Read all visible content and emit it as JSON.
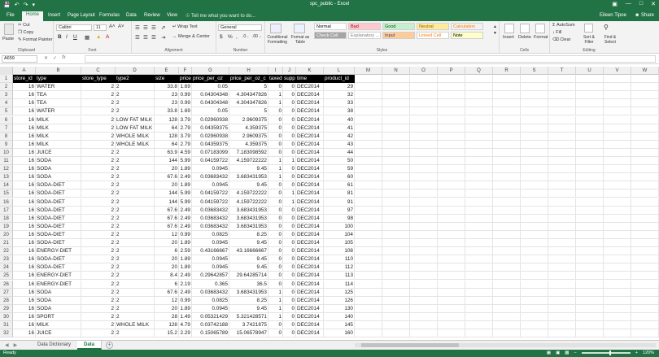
{
  "window": {
    "title": "spc_public - Excel",
    "user": "Eileen Tipoe",
    "share": "Share"
  },
  "tabs": [
    "File",
    "Home",
    "Insert",
    "Page Layout",
    "Formulas",
    "Data",
    "Review",
    "View"
  ],
  "tell_me": "Tell me what you want to do...",
  "ribbon": {
    "clipboard": {
      "paste": "Paste",
      "cut": "Cut",
      "copy": "Copy",
      "format_painter": "Format Painter",
      "label": "Clipboard"
    },
    "font": {
      "name": "Calibri",
      "size": "11",
      "label": "Font"
    },
    "alignment": {
      "wrap": "Wrap Text",
      "merge": "Merge & Center",
      "label": "Alignment"
    },
    "number": {
      "format": "General",
      "label": "Number"
    },
    "styles": {
      "conditional": "Conditional Formatting",
      "format_table": "Format as Table",
      "cells": [
        {
          "name": "Normal",
          "bg": "#ffffff",
          "fg": "#000000"
        },
        {
          "name": "Bad",
          "bg": "#ffc7ce",
          "fg": "#9c0006"
        },
        {
          "name": "Good",
          "bg": "#c6efce",
          "fg": "#006100"
        },
        {
          "name": "Neutral",
          "bg": "#ffeb9c",
          "fg": "#9c5700"
        },
        {
          "name": "Calculation",
          "bg": "#f2f2f2",
          "fg": "#fa7d00"
        },
        {
          "name": "Check Cell",
          "bg": "#a5a5a5",
          "fg": "#ffffff"
        },
        {
          "name": "Explanatory ...",
          "bg": "#ffffff",
          "fg": "#7f7f7f"
        },
        {
          "name": "Input",
          "bg": "#ffcc99",
          "fg": "#3f3f76"
        },
        {
          "name": "Linked Cell",
          "bg": "#ffffff",
          "fg": "#fa7d00"
        },
        {
          "name": "Note",
          "bg": "#ffffcc",
          "fg": "#000000"
        }
      ],
      "label": "Styles"
    },
    "cells": {
      "insert": "Insert",
      "delete": "Delete",
      "format": "Format",
      "label": "Cells"
    },
    "editing": {
      "autosum": "AutoSum",
      "fill": "Fill",
      "clear": "Clear",
      "sort": "Sort & Filter",
      "find": "Find & Select",
      "label": "Editing"
    }
  },
  "formula_bar": {
    "name_box": "A659",
    "fx": "fx"
  },
  "columns": [
    "A",
    "B",
    "C",
    "D",
    "E",
    "F",
    "G",
    "H",
    "I",
    "J",
    "K",
    "L",
    "M",
    "N",
    "O",
    "P",
    "Q",
    "R",
    "S",
    "T",
    "U",
    "V",
    "W"
  ],
  "row_numbers": [
    "1",
    "2",
    "3",
    "4",
    "5",
    "6",
    "7",
    "8",
    "9",
    "10",
    "11",
    "12",
    "13",
    "14",
    "15",
    "16",
    "17",
    "18",
    "19",
    "20",
    "21",
    "22",
    "23",
    "24",
    "25",
    "26",
    "27",
    "28",
    "29",
    "30",
    "31",
    "32"
  ],
  "header_row": [
    "store_id",
    "type",
    "store_type",
    "type2",
    "size",
    "price",
    "price_per_oz",
    "price_per_oz_c",
    "taxed",
    "supp",
    "time",
    "product_id"
  ],
  "rows": [
    [
      "16",
      "WATER",
      "2",
      "2",
      "33.8",
      "1.69",
      "0.05",
      "5",
      "0",
      "0",
      "DEC2014",
      "29"
    ],
    [
      "16",
      "TEA",
      "2",
      "2",
      "23",
      "0.99",
      "0.04304348",
      "4.304347826",
      "1",
      "0",
      "DEC2014",
      "32"
    ],
    [
      "16",
      "TEA",
      "2",
      "2",
      "23",
      "0.99",
      "0.04304348",
      "4.304347826",
      "1",
      "0",
      "DEC2014",
      "33"
    ],
    [
      "16",
      "WATER",
      "2",
      "2",
      "33.8",
      "1.69",
      "0.05",
      "5",
      "0",
      "0",
      "DEC2014",
      "38"
    ],
    [
      "16",
      "MILK",
      "2",
      "LOW FAT MILK",
      "128",
      "3.79",
      "0.02960938",
      "2.9609375",
      "0",
      "0",
      "DEC2014",
      "40"
    ],
    [
      "16",
      "MILK",
      "2",
      "LOW FAT MILK",
      "64",
      "2.79",
      "0.04359375",
      "4.359375",
      "0",
      "0",
      "DEC2014",
      "41"
    ],
    [
      "16",
      "MILK",
      "2",
      "WHOLE MILK",
      "128",
      "3.79",
      "0.02960938",
      "2.9609375",
      "0",
      "0",
      "DEC2014",
      "42"
    ],
    [
      "16",
      "MILK",
      "2",
      "WHOLE MILK",
      "64",
      "2.79",
      "0.04359375",
      "4.359375",
      "0",
      "0",
      "DEC2014",
      "43"
    ],
    [
      "16",
      "JUICE",
      "2",
      "2",
      "63.9",
      "4.59",
      "0.07183099",
      "7.183098592",
      "0",
      "0",
      "DEC2014",
      "44"
    ],
    [
      "16",
      "SODA",
      "2",
      "2",
      "144",
      "5.99",
      "0.04159722",
      "4.159722222",
      "1",
      "1",
      "DEC2014",
      "50"
    ],
    [
      "16",
      "SODA",
      "2",
      "2",
      "20",
      "1.89",
      "0.0945",
      "9.45",
      "1",
      "0",
      "DEC2014",
      "59"
    ],
    [
      "16",
      "SODA",
      "2",
      "2",
      "67.6",
      "2.49",
      "0.03683432",
      "3.683431953",
      "1",
      "0",
      "DEC2014",
      "60"
    ],
    [
      "16",
      "SODA-DIET",
      "2",
      "2",
      "20",
      "1.89",
      "0.0945",
      "9.45",
      "0",
      "0",
      "DEC2014",
      "61"
    ],
    [
      "16",
      "SODA-DIET",
      "2",
      "2",
      "144",
      "5.99",
      "0.04159722",
      "4.159722222",
      "0",
      "1",
      "DEC2014",
      "81"
    ],
    [
      "16",
      "SODA-DIET",
      "2",
      "2",
      "144",
      "5.99",
      "0.04159722",
      "4.159722222",
      "0",
      "1",
      "DEC2014",
      "91"
    ],
    [
      "16",
      "SODA-DIET",
      "2",
      "2",
      "67.6",
      "2.49",
      "0.03683432",
      "3.683431953",
      "0",
      "0",
      "DEC2014",
      "97"
    ],
    [
      "16",
      "SODA-DIET",
      "2",
      "2",
      "67.6",
      "2.49",
      "0.03683432",
      "3.683431953",
      "0",
      "0",
      "DEC2014",
      "98"
    ],
    [
      "16",
      "SODA-DIET",
      "2",
      "2",
      "67.6",
      "2.49",
      "0.03683432",
      "3.683431953",
      "0",
      "0",
      "DEC2014",
      "100"
    ],
    [
      "16",
      "SODA-DIET",
      "2",
      "2",
      "12",
      "0.99",
      "0.0825",
      "8.25",
      "0",
      "0",
      "DEC2014",
      "104"
    ],
    [
      "16",
      "SODA-DIET",
      "2",
      "2",
      "20",
      "1.89",
      "0.0945",
      "9.45",
      "0",
      "0",
      "DEC2014",
      "105"
    ],
    [
      "16",
      "ENERGY-DIET",
      "2",
      "2",
      "6",
      "2.59",
      "0.43166667",
      "43.16666667",
      "0",
      "0",
      "DEC2014",
      "108"
    ],
    [
      "16",
      "SODA-DIET",
      "2",
      "2",
      "20",
      "1.89",
      "0.0945",
      "9.45",
      "0",
      "0",
      "DEC2014",
      "110"
    ],
    [
      "16",
      "SODA-DIET",
      "2",
      "2",
      "20",
      "1.89",
      "0.0945",
      "9.45",
      "0",
      "0",
      "DEC2014",
      "112"
    ],
    [
      "16",
      "ENERGY-DIET",
      "2",
      "2",
      "8.4",
      "2.49",
      "0.29642857",
      "29.64285714",
      "0",
      "0",
      "DEC2014",
      "113"
    ],
    [
      "16",
      "ENERGY-DIET",
      "2",
      "2",
      "6",
      "2.19",
      "0.365",
      "36.5",
      "0",
      "0",
      "DEC2014",
      "114"
    ],
    [
      "16",
      "SODA",
      "2",
      "2",
      "67.6",
      "2.49",
      "0.03683432",
      "3.683431953",
      "1",
      "0",
      "DEC2014",
      "125"
    ],
    [
      "16",
      "SODA",
      "2",
      "2",
      "12",
      "0.99",
      "0.0825",
      "8.25",
      "1",
      "0",
      "DEC2014",
      "126"
    ],
    [
      "16",
      "SODA",
      "2",
      "2",
      "20",
      "1.89",
      "0.0945",
      "9.45",
      "1",
      "0",
      "DEC2014",
      "130"
    ],
    [
      "16",
      "SPORT",
      "2",
      "2",
      "28",
      "1.49",
      "0.05321429",
      "5.321428571",
      "1",
      "0",
      "DEC2014",
      "140"
    ],
    [
      "16",
      "MILK",
      "2",
      "WHOLE MILK",
      "128",
      "4.79",
      "0.03742188",
      "3.7421875",
      "0",
      "0",
      "DEC2014",
      "145"
    ],
    [
      "16",
      "JUICE",
      "2",
      "2",
      "15.2",
      "2.29",
      "0.15065789",
      "15.06578947",
      "0",
      "0",
      "DEC2014",
      "160"
    ]
  ],
  "sheets": [
    "Data Dictionary",
    "Data"
  ],
  "active_sheet": "Data",
  "status": {
    "ready": "Ready",
    "zoom": "120%"
  },
  "colors": {
    "accent": "#217346"
  }
}
